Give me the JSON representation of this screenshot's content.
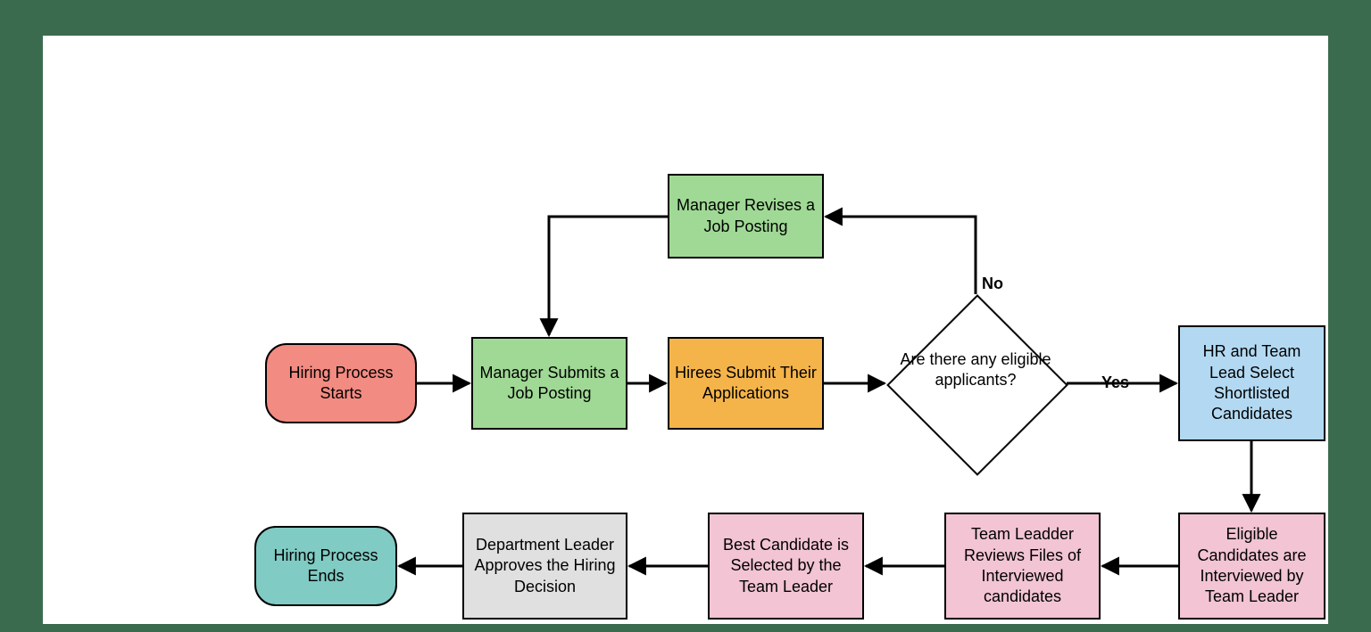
{
  "nodes": {
    "start": {
      "label": "Hiring Process Starts",
      "color": "#f28b82"
    },
    "submit": {
      "label": "Manager Submits a Job Posting",
      "color": "#a0d995"
    },
    "revise": {
      "label": "Manager Revises a Job Posting",
      "color": "#a0d995"
    },
    "hirees": {
      "label": "Hirees Submit Their Applications",
      "color": "#f5b44a"
    },
    "decision": {
      "label": "Are there any eligible applicants?",
      "color": "#ffffff"
    },
    "shortlist": {
      "label": "HR and Team Lead Select Shortlisted Candidates",
      "color": "#b3d9f2"
    },
    "interview": {
      "label": "Eligible Candidates are Interviewed by Team Leader",
      "color": "#f2c4d4"
    },
    "review": {
      "label": "Team Leadder Reviews  Files of Interviewed candidates",
      "color": "#f2c4d4"
    },
    "best": {
      "label": "Best Candidate is Selected by the Team Leader",
      "color": "#f2c4d4"
    },
    "approve": {
      "label": "Department Leader Approves the Hiring Decision",
      "color": "#e0e0e0"
    },
    "end": {
      "label": "Hiring Process Ends",
      "color": "#80cbc4"
    }
  },
  "edges": {
    "no": "No",
    "yes": "Yes"
  }
}
